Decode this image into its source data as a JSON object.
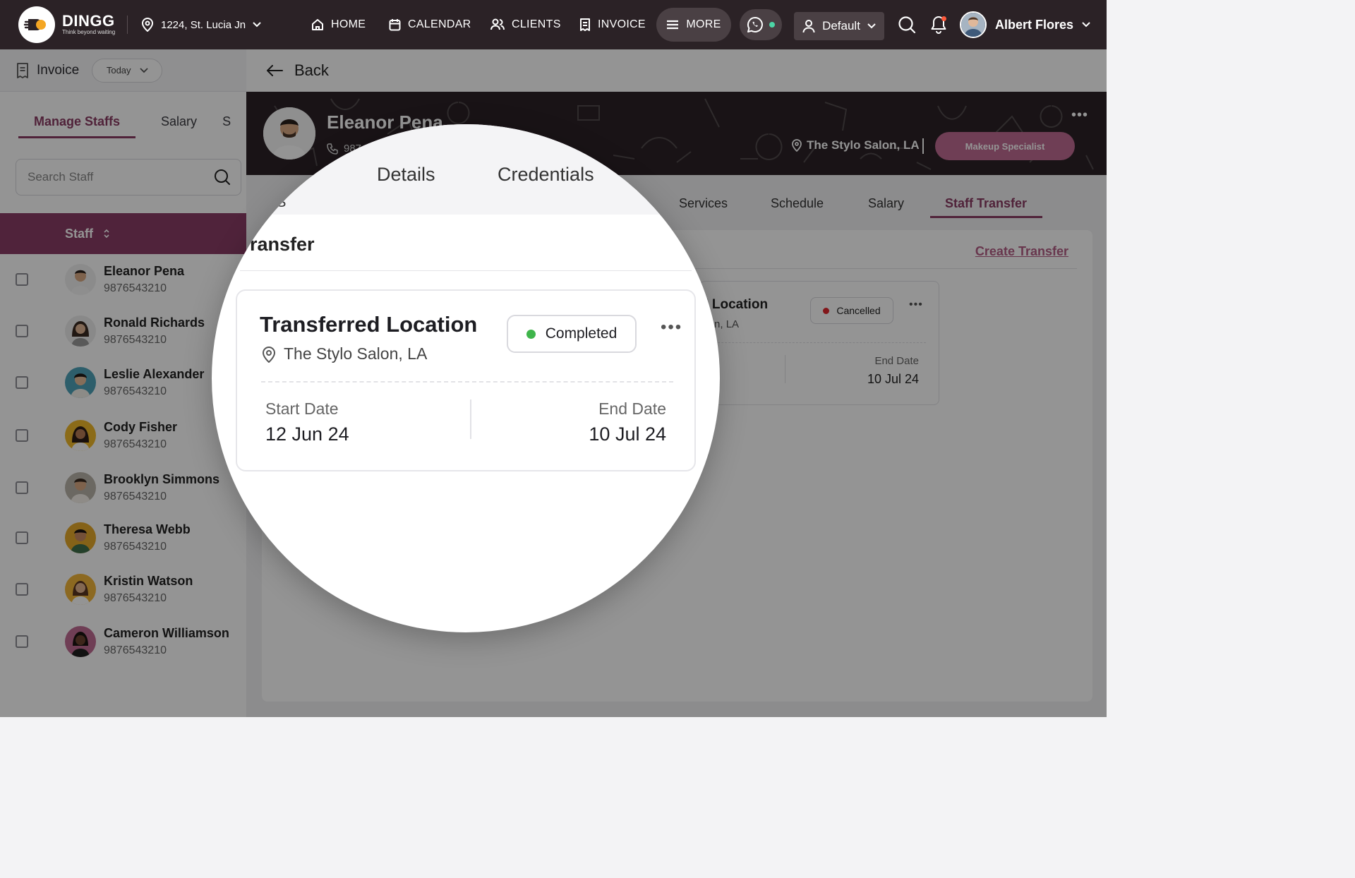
{
  "brand": {
    "name": "DINGG",
    "tagline": "Think beyond waiting"
  },
  "topbar": {
    "location": "1224, St. Lucia Jn",
    "nav": [
      {
        "label": "HOME",
        "icon": "home-icon"
      },
      {
        "label": "CALENDAR",
        "icon": "calendar-icon"
      },
      {
        "label": "CLIENTS",
        "icon": "users-icon"
      },
      {
        "label": "INVOICE",
        "icon": "receipt-icon"
      }
    ],
    "more_label": "MORE",
    "default_label": "Default",
    "user_name": "Albert Flores"
  },
  "left": {
    "title": "Invoice",
    "date_filter": "Today",
    "tabs": [
      "Manage Staffs",
      "Salary",
      "S"
    ],
    "search_placeholder": "Search Staff",
    "table_header": "Staff",
    "staff": [
      {
        "name": "Eleanor Pena",
        "phone": "9876543210"
      },
      {
        "name": "Ronald Richards",
        "phone": "9876543210"
      },
      {
        "name": "Leslie Alexander",
        "phone": "9876543210"
      },
      {
        "name": "Cody Fisher",
        "phone": "9876543210"
      },
      {
        "name": "Brooklyn Simmons",
        "phone": "9876543210"
      },
      {
        "name": "Theresa Webb",
        "phone": "9876543210"
      },
      {
        "name": "Kristin Watson",
        "phone": "9876543210"
      },
      {
        "name": "Cameron Williamson",
        "phone": "9876543210"
      }
    ]
  },
  "main": {
    "back_label": "Back",
    "profile": {
      "name": "Eleanor Pena",
      "phone_partial": "987",
      "location": "The Stylo Salon, LA",
      "role": "Makeup Specialist"
    },
    "tabs": [
      "Services",
      "Schedule",
      "Salary",
      "Staff Transfer"
    ],
    "create_transfer": "Create Transfer",
    "transfer_card": {
      "title_partial": "d Location",
      "location_partial": "alon, LA",
      "status": "Cancelled",
      "end_label": "End Date",
      "end_value": "10 Jul 24"
    }
  },
  "magnifier": {
    "tab_partial": "S",
    "tabs": [
      "Details",
      "Credentials"
    ],
    "section_title": "ransfer",
    "card": {
      "title": "Transferred Location",
      "location": "The Stylo Salon, LA",
      "status": "Completed",
      "start_label": "Start Date",
      "start_value": "12 Jun 24",
      "end_label": "End Date",
      "end_value": "10 Jul 24"
    }
  },
  "colors": {
    "topbar_bg": "#2b2226",
    "accent": "#8a3b63",
    "role_pill": "#c06b93",
    "status_completed": "#3fb54b",
    "status_cancelled": "#e0262d"
  }
}
